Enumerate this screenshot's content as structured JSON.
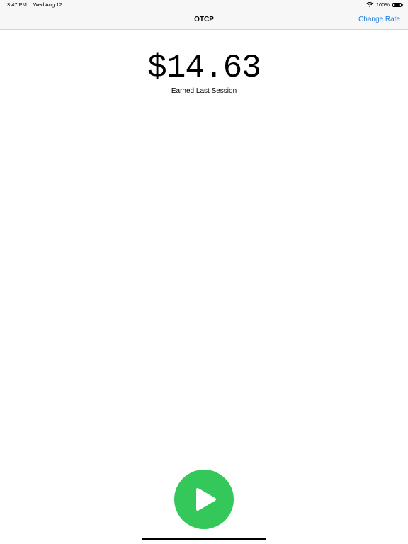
{
  "status_bar": {
    "time": "3:47 PM",
    "date": "Wed Aug 12",
    "battery_text": "100%",
    "battery_level": 1.0,
    "icons": [
      "wifi-icon",
      "battery-icon"
    ]
  },
  "nav": {
    "title": "OTCP",
    "action_label": "Change Rate"
  },
  "main": {
    "amount": "$14.63",
    "caption": "Earned Last Session"
  },
  "controls": {
    "play_icon": "play-icon"
  },
  "colors": {
    "accent": "#1a7ce6",
    "play_button": "#34c759",
    "bar_background": "#f7f7f7"
  }
}
